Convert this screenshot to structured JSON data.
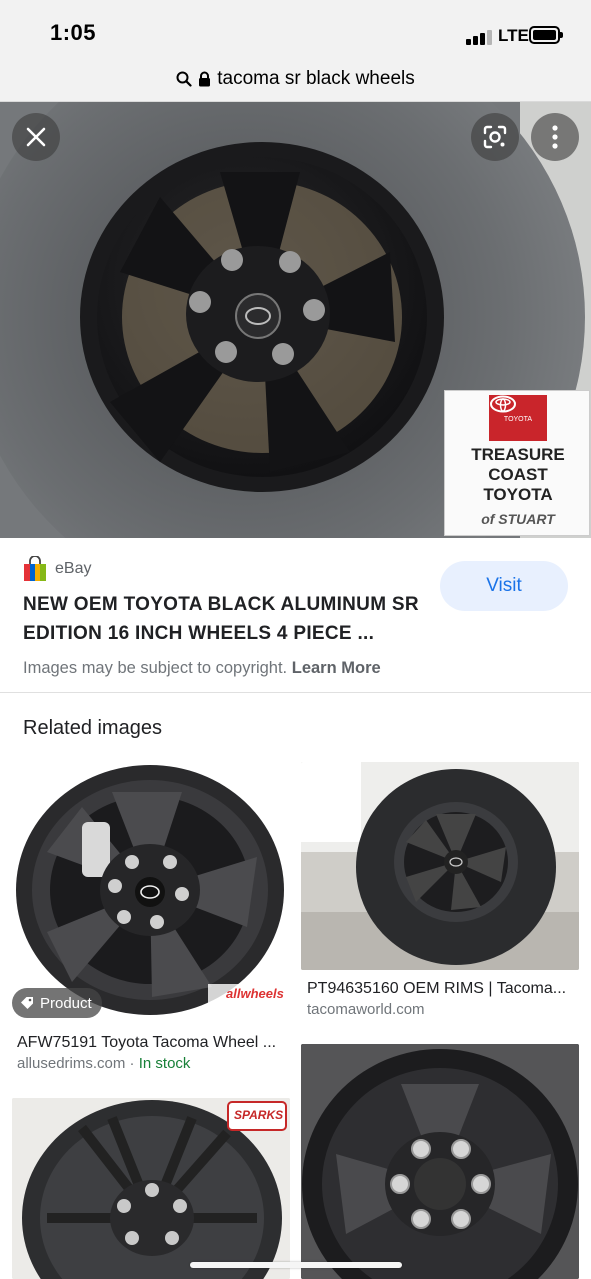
{
  "status_bar": {
    "time": "1:05",
    "network": "LTE"
  },
  "url_bar": {
    "query": "tacoma sr black wheels"
  },
  "main_image": {
    "description_icons": [
      "close-icon",
      "lens-icon",
      "more-vert-icon"
    ],
    "watermark": {
      "brand": "TOYOTA",
      "line1": "TREASURE",
      "line2": "COAST",
      "line3": "TOYOTA",
      "line4": "of STUART"
    }
  },
  "result": {
    "source": "eBay",
    "title": "NEW OEM TOYOTA BLACK ALUMINUM SR EDITION 16 INCH WHEELS 4 PIECE ...",
    "visit_label": "Visit",
    "copyright_text": "Images may be subject to copyright.",
    "learn_more_label": "Learn More"
  },
  "related": {
    "heading": "Related images",
    "items": [
      {
        "chip": "Product",
        "title": "AFW75191 Toyota Tacoma Wheel ...",
        "source": "allusedrims.com",
        "separator": " · ",
        "status": "In stock",
        "watermark": "allwheels"
      },
      {
        "title": "PT94635160 OEM RIMS | Tacoma...",
        "source": "tacomaworld.com"
      },
      {
        "watermark": "SPARKS"
      },
      {}
    ]
  },
  "colors": {
    "accent": "#1a73e8",
    "visit_bg": "#e8f0fe",
    "in_stock": "#188038",
    "toyota_red": "#c9252b"
  }
}
